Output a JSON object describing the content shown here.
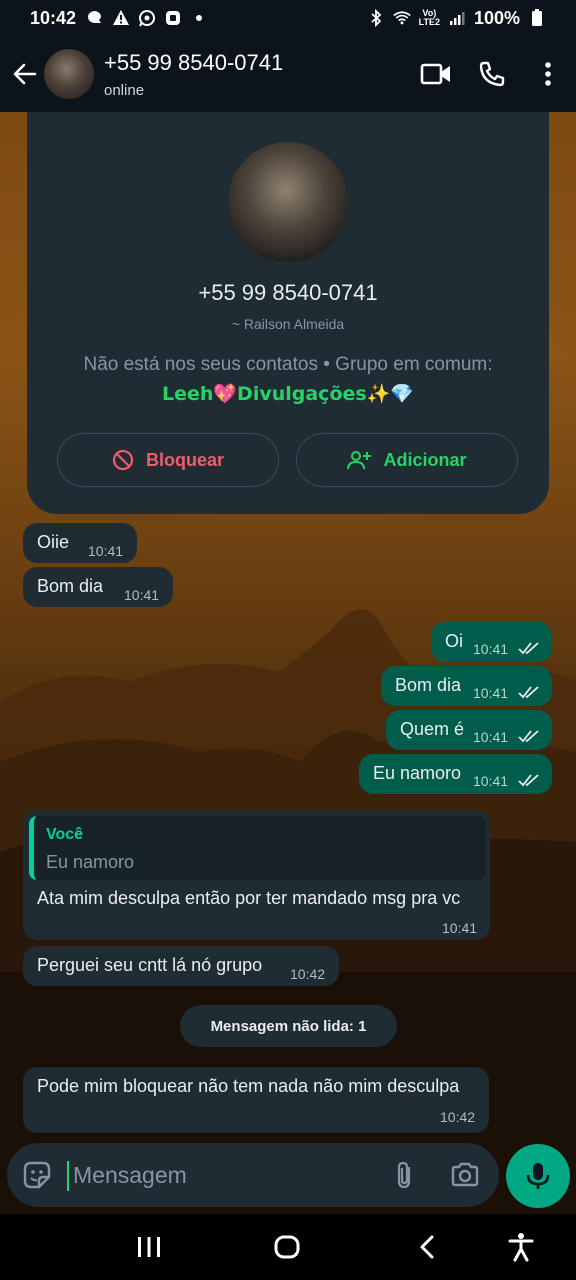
{
  "status_bar": {
    "time": "10:42",
    "volte": "Vo)\nLTE2",
    "battery": "100%"
  },
  "header": {
    "contact": "+55 99 8540-0741",
    "status": "online"
  },
  "contact_card": {
    "phone": "+55 99 8540-0741",
    "profile_name": "~ Railson Almeida",
    "info": "Não está nos seus contatos • Grupo em comum:",
    "group": "Leeh💖Divulgações✨💎",
    "block_label": "Bloquear",
    "add_label": "Adicionar"
  },
  "messages": [
    {
      "dir": "in",
      "text": "Oiie",
      "time": "10:41"
    },
    {
      "dir": "in",
      "text": "Bom dia",
      "time": "10:41"
    },
    {
      "dir": "out",
      "text": "Oi",
      "time": "10:41"
    },
    {
      "dir": "out",
      "text": "Bom dia",
      "time": "10:41"
    },
    {
      "dir": "out",
      "text": "Quem é",
      "time": "10:41"
    },
    {
      "dir": "out",
      "text": "Eu namoro",
      "time": "10:41"
    },
    {
      "dir": "in",
      "quote_author": "Você",
      "quote_text": "Eu namoro",
      "text": "Ata mim desculpa então por ter mandado msg pra vc",
      "time": "10:41"
    },
    {
      "dir": "in",
      "text": "Perguei seu cntt lá nó grupo",
      "time": "10:42"
    },
    {
      "dir": "in",
      "text": "Pode mim bloquear não tem nada não mim desculpa",
      "time": "10:42"
    }
  ],
  "unread_label": "Mensagem não lida: 1",
  "composer": {
    "placeholder": "Mensagem"
  },
  "colors": {
    "incoming_bubble": "#1f2c33",
    "outgoing_bubble": "#005c4b",
    "accent": "#25d366",
    "danger": "#f15c6d"
  }
}
